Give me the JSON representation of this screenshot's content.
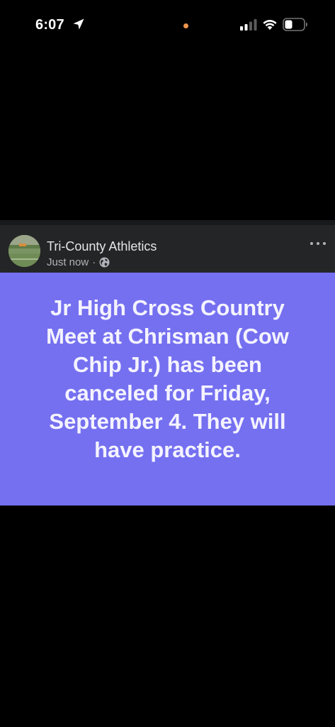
{
  "status_bar": {
    "time": "6:07",
    "privacy_dot_color": "#f0954a",
    "icons": [
      "location-arrow-icon",
      "cellular-signal-icon",
      "wifi-icon",
      "battery-icon"
    ]
  },
  "post": {
    "page_name": "Tri-County Athletics",
    "timestamp": "Just now",
    "separator": "·",
    "audience_icon": "globe-icon",
    "more_icon": "more-options-icon",
    "background_color": "#7570f0",
    "text": "Jr High Cross Country Meet at Chrisman (Cow Chip Jr.) has been canceled for Friday, September 4. They will have practice."
  }
}
